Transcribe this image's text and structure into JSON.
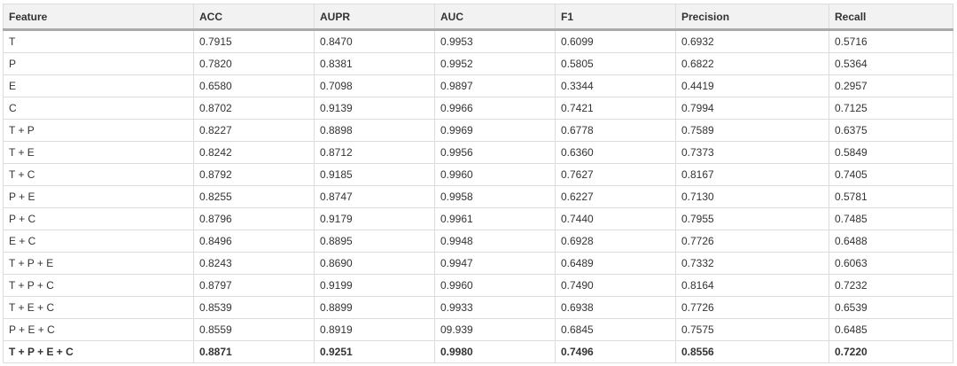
{
  "table": {
    "headers": [
      "Feature",
      "ACC",
      "AUPR",
      "AUC",
      "F1",
      "Precision",
      "Recall"
    ],
    "rows": [
      [
        "T",
        "0.7915",
        "0.8470",
        "0.9953",
        "0.6099",
        "0.6932",
        "0.5716"
      ],
      [
        "P",
        "0.7820",
        "0.8381",
        "0.9952",
        "0.5805",
        "0.6822",
        "0.5364"
      ],
      [
        "E",
        "0.6580",
        "0.7098",
        "0.9897",
        "0.3344",
        "0.4419",
        "0.2957"
      ],
      [
        "C",
        "0.8702",
        "0.9139",
        "0.9966",
        "0.7421",
        "0.7994",
        "0.7125"
      ],
      [
        "T + P",
        "0.8227",
        "0.8898",
        "0.9969",
        "0.6778",
        "0.7589",
        "0.6375"
      ],
      [
        "T + E",
        "0.8242",
        "0.8712",
        "0.9956",
        "0.6360",
        "0.7373",
        "0.5849"
      ],
      [
        "T + C",
        "0.8792",
        "0.9185",
        "0.9960",
        "0.7627",
        "0.8167",
        "0.7405"
      ],
      [
        "P + E",
        "0.8255",
        "0.8747",
        "0.9958",
        "0.6227",
        "0.7130",
        "0.5781"
      ],
      [
        "P + C",
        "0.8796",
        "0.9179",
        "0.9961",
        "0.7440",
        "0.7955",
        "0.7485"
      ],
      [
        "E + C",
        "0.8496",
        "0.8895",
        "0.9948",
        "0.6928",
        "0.7726",
        "0.6488"
      ],
      [
        "T + P + E",
        "0.8243",
        "0.8690",
        "0.9947",
        "0.6489",
        "0.7332",
        "0.6063"
      ],
      [
        "T + P + C",
        "0.8797",
        "0.9199",
        "0.9960",
        "0.7490",
        "0.8164",
        "0.7232"
      ],
      [
        "T + E + C",
        "0.8539",
        "0.8899",
        "0.9933",
        "0.6938",
        "0.7726",
        "0.6539"
      ],
      [
        "P + E + C",
        "0.8559",
        "0.8919",
        "09.939",
        "0.6845",
        "0.7575",
        "0.6485"
      ],
      [
        "T + P + E + C",
        "0.8871",
        "0.9251",
        "0.9980",
        "0.7496",
        "0.8556",
        "0.7220"
      ]
    ]
  }
}
